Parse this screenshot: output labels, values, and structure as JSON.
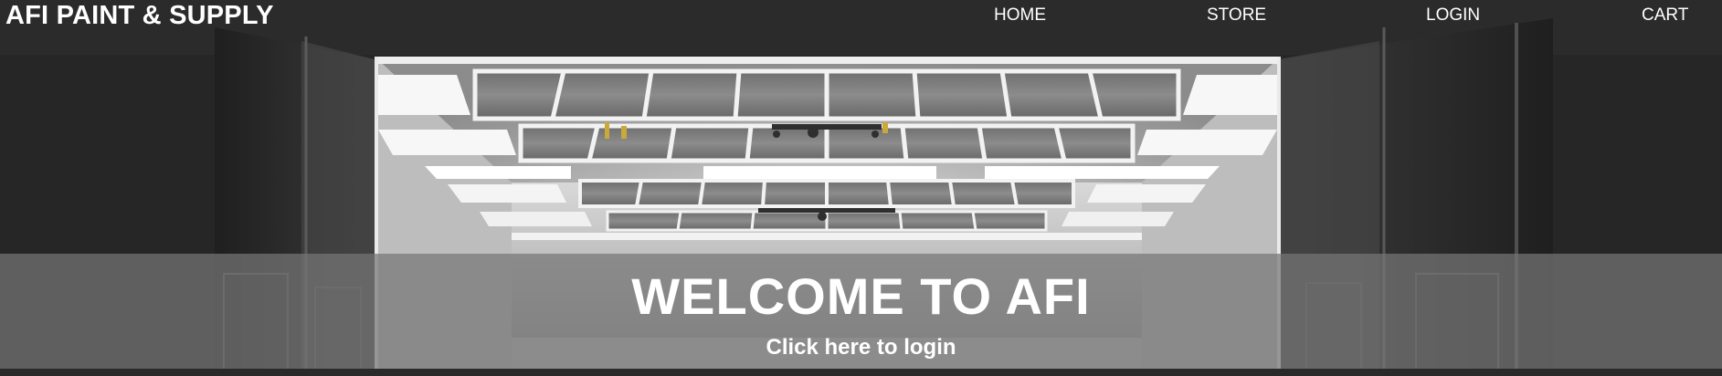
{
  "header": {
    "brand": "AFI PAINT & SUPPLY",
    "nav": {
      "home": "HOME",
      "store": "STORE",
      "login": "LOGIN",
      "cart": "CART"
    }
  },
  "hero": {
    "title": "WELCOME TO AFI",
    "cta": "Click here to login",
    "image": "paint-booth-photo"
  },
  "colors": {
    "page_background": "#262626",
    "banner_overlay": "rgba(118,118,118,0.72)",
    "text": "#ffffff"
  }
}
